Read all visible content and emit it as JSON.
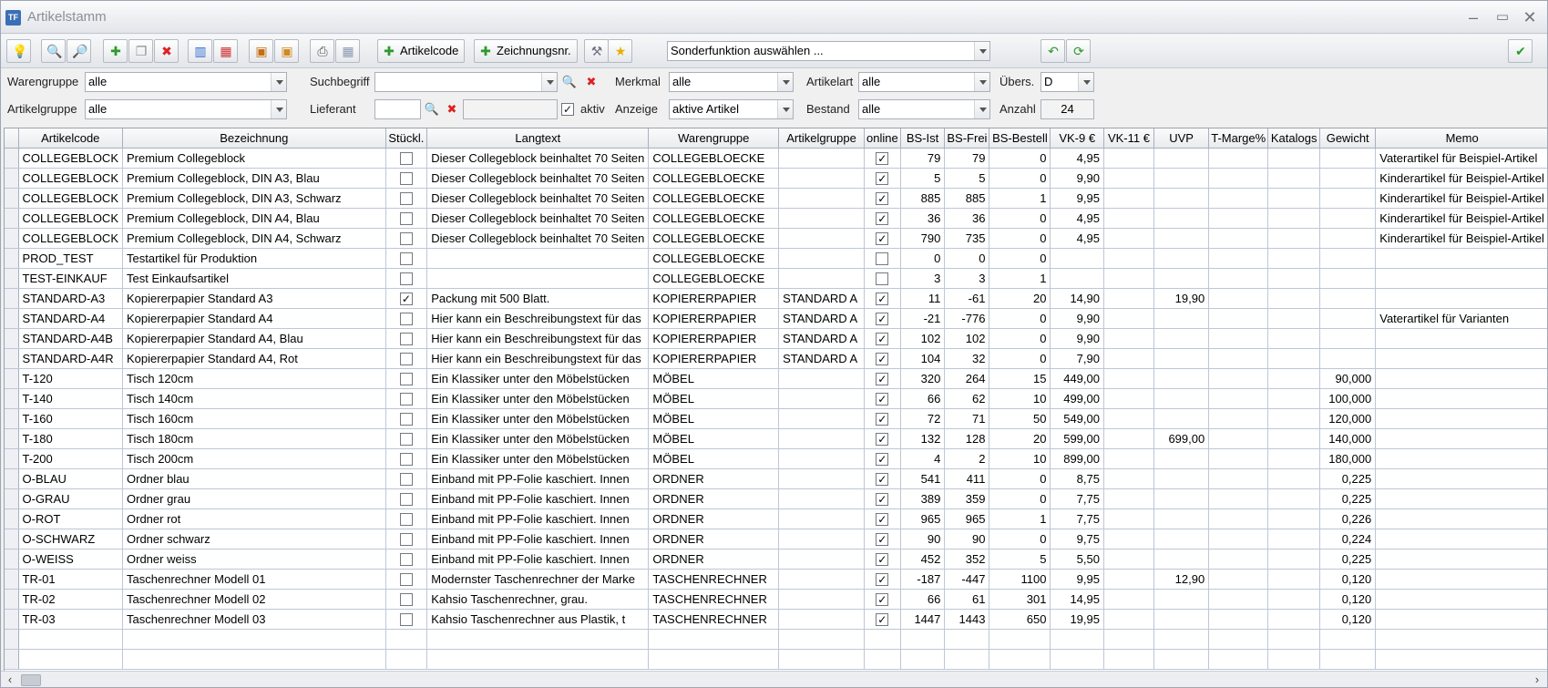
{
  "window": {
    "title": "Artikelstamm",
    "app_icon_text": "TF",
    "minimize": "–",
    "maximize": "▭",
    "close": "✕"
  },
  "toolbar": {
    "artikelcode_label": "Artikelcode",
    "zeichnungsnr_label": "Zeichnungsnr.",
    "sonderfunktion_value": "Sonderfunktion auswählen ..."
  },
  "filters": {
    "warengruppe_label": "Warengruppe",
    "warengruppe_value": "alle",
    "artikelgruppe_label": "Artikelgruppe",
    "artikelgruppe_value": "alle",
    "suchbegriff_label": "Suchbegriff",
    "suchbegriff_value": "",
    "lieferant_label": "Lieferant",
    "lieferant_value": "",
    "aktiv_label": "aktiv",
    "merkmal_label": "Merkmal",
    "merkmal_value": "alle",
    "anzeige_label": "Anzeige",
    "anzeige_value": "aktive Artikel",
    "artikelart_label": "Artikelart",
    "artikelart_value": "alle",
    "bestand_label": "Bestand",
    "bestand_value": "alle",
    "uebers_label": "Übers.",
    "uebers_value": "D",
    "anzahl_label": "Anzahl",
    "anzahl_value": "24"
  },
  "table": {
    "columns": [
      "Artikelcode",
      "Bezeichnung",
      "Stückl.",
      "Langtext",
      "Warengruppe",
      "Artikelgruppe",
      "online",
      "BS-Ist",
      "BS-Frei",
      "BS-Bestell",
      "VK-9 €",
      "VK-11 €",
      "UVP",
      "T-Marge%",
      "Katalogs",
      "Gewicht",
      "Memo"
    ],
    "rows": [
      [
        "COLLEGEBLOCK",
        "Premium Collegeblock",
        false,
        "Dieser Collegeblock beinhaltet 70 Seiten",
        "COLLEGEBLOECKE",
        "",
        true,
        "79",
        "79",
        "0",
        "4,95",
        "",
        "",
        "",
        "",
        "",
        "Vaterartikel für Beispiel-Artikel"
      ],
      [
        "COLLEGEBLOCK",
        "Premium Collegeblock, DIN A3, Blau",
        false,
        "Dieser Collegeblock beinhaltet 70 Seiten",
        "COLLEGEBLOECKE",
        "",
        true,
        "5",
        "5",
        "0",
        "9,90",
        "",
        "",
        "",
        "",
        "",
        "Kinderartikel für Beispiel-Artikel"
      ],
      [
        "COLLEGEBLOCK",
        "Premium Collegeblock, DIN A3, Schwarz",
        false,
        "Dieser Collegeblock beinhaltet 70 Seiten",
        "COLLEGEBLOECKE",
        "",
        true,
        "885",
        "885",
        "1",
        "9,95",
        "",
        "",
        "",
        "",
        "",
        "Kinderartikel für Beispiel-Artikel"
      ],
      [
        "COLLEGEBLOCK",
        "Premium Collegeblock, DIN A4, Blau",
        false,
        "Dieser Collegeblock beinhaltet 70 Seiten",
        "COLLEGEBLOECKE",
        "",
        true,
        "36",
        "36",
        "0",
        "4,95",
        "",
        "",
        "",
        "",
        "",
        "Kinderartikel für Beispiel-Artikel"
      ],
      [
        "COLLEGEBLOCK",
        "Premium Collegeblock, DIN A4, Schwarz",
        false,
        "Dieser Collegeblock beinhaltet 70 Seiten",
        "COLLEGEBLOECKE",
        "",
        true,
        "790",
        "735",
        "0",
        "4,95",
        "",
        "",
        "",
        "",
        "",
        "Kinderartikel für Beispiel-Artikel"
      ],
      [
        "PROD_TEST",
        "Testartikel für Produktion",
        false,
        "",
        "COLLEGEBLOECKE",
        "",
        false,
        "0",
        "0",
        "0",
        "",
        "",
        "",
        "",
        "",
        "",
        ""
      ],
      [
        "TEST-EINKAUF",
        "Test Einkaufsartikel",
        false,
        "",
        "COLLEGEBLOECKE",
        "",
        false,
        "3",
        "3",
        "1",
        "",
        "",
        "",
        "",
        "",
        "",
        ""
      ],
      [
        "STANDARD-A3",
        "Kopiererpapier Standard A3",
        true,
        "Packung mit 500 Blatt.",
        "KOPIERERPAPIER",
        "STANDARD A",
        true,
        "11",
        "-61",
        "20",
        "14,90",
        "",
        "19,90",
        "",
        "",
        "",
        ""
      ],
      [
        "STANDARD-A4",
        "Kopiererpapier Standard A4",
        false,
        "Hier kann ein Beschreibungstext für das",
        "KOPIERERPAPIER",
        "STANDARD A",
        true,
        "-21",
        "-776",
        "0",
        "9,90",
        "",
        "",
        "",
        "",
        "",
        "Vaterartikel für Varianten"
      ],
      [
        "STANDARD-A4B",
        "Kopiererpapier Standard A4, Blau",
        false,
        "Hier kann ein Beschreibungstext für das",
        "KOPIERERPAPIER",
        "STANDARD A",
        true,
        "102",
        "102",
        "0",
        "9,90",
        "",
        "",
        "",
        "",
        "",
        ""
      ],
      [
        "STANDARD-A4R",
        "Kopiererpapier Standard A4, Rot",
        false,
        "Hier kann ein Beschreibungstext für das",
        "KOPIERERPAPIER",
        "STANDARD A",
        true,
        "104",
        "32",
        "0",
        "7,90",
        "",
        "",
        "",
        "",
        "",
        ""
      ],
      [
        "T-120",
        "Tisch 120cm",
        false,
        "Ein Klassiker unter den Möbelstücken",
        "MÖBEL",
        "",
        true,
        "320",
        "264",
        "15",
        "449,00",
        "",
        "",
        "",
        "",
        "90,000",
        ""
      ],
      [
        "T-140",
        "Tisch 140cm",
        false,
        "Ein Klassiker unter den Möbelstücken",
        "MÖBEL",
        "",
        true,
        "66",
        "62",
        "10",
        "499,00",
        "",
        "",
        "",
        "",
        "100,000",
        ""
      ],
      [
        "T-160",
        "Tisch 160cm",
        false,
        "Ein Klassiker unter den Möbelstücken",
        "MÖBEL",
        "",
        true,
        "72",
        "71",
        "50",
        "549,00",
        "",
        "",
        "",
        "",
        "120,000",
        ""
      ],
      [
        "T-180",
        "Tisch 180cm",
        false,
        "Ein Klassiker unter den Möbelstücken",
        "MÖBEL",
        "",
        true,
        "132",
        "128",
        "20",
        "599,00",
        "",
        "699,00",
        "",
        "",
        "140,000",
        ""
      ],
      [
        "T-200",
        "Tisch 200cm",
        false,
        "Ein Klassiker unter den Möbelstücken",
        "MÖBEL",
        "",
        true,
        "4",
        "2",
        "10",
        "899,00",
        "",
        "",
        "",
        "",
        "180,000",
        ""
      ],
      [
        "O-BLAU",
        "Ordner blau",
        false,
        "Einband mit PP-Folie kaschiert. Innen",
        "ORDNER",
        "",
        true,
        "541",
        "411",
        "0",
        "8,75",
        "",
        "",
        "",
        "",
        "0,225",
        ""
      ],
      [
        "O-GRAU",
        "Ordner grau",
        false,
        "Einband mit PP-Folie kaschiert. Innen",
        "ORDNER",
        "",
        true,
        "389",
        "359",
        "0",
        "7,75",
        "",
        "",
        "",
        "",
        "0,225",
        ""
      ],
      [
        "O-ROT",
        "Ordner rot",
        false,
        "Einband mit PP-Folie kaschiert. Innen",
        "ORDNER",
        "",
        true,
        "965",
        "965",
        "1",
        "7,75",
        "",
        "",
        "",
        "",
        "0,226",
        ""
      ],
      [
        "O-SCHWARZ",
        "Ordner schwarz",
        false,
        "Einband mit PP-Folie kaschiert. Innen",
        "ORDNER",
        "",
        true,
        "90",
        "90",
        "0",
        "9,75",
        "",
        "",
        "",
        "",
        "0,224",
        ""
      ],
      [
        "O-WEISS",
        "Ordner weiss",
        false,
        "Einband mit PP-Folie kaschiert. Innen",
        "ORDNER",
        "",
        true,
        "452",
        "352",
        "5",
        "5,50",
        "",
        "",
        "",
        "",
        "0,225",
        ""
      ],
      [
        "TR-01",
        "Taschenrechner Modell 01",
        false,
        "Modernster Taschenrechner der Marke",
        "TASCHENRECHNER",
        "",
        true,
        "-187",
        "-447",
        "1100",
        "9,95",
        "",
        "12,90",
        "",
        "",
        "0,120",
        ""
      ],
      [
        "TR-02",
        "Taschenrechner Modell 02",
        false,
        "Kahsio Taschenrechner, grau.",
        "TASCHENRECHNER",
        "",
        true,
        "66",
        "61",
        "301",
        "14,95",
        "",
        "",
        "",
        "",
        "0,120",
        ""
      ],
      [
        "TR-03",
        "Taschenrechner Modell 03",
        false,
        "Kahsio Taschenrechner aus Plastik, t",
        "TASCHENRECHNER",
        "",
        true,
        "1447",
        "1443",
        "650",
        "19,95",
        "",
        "",
        "",
        "",
        "0,120",
        ""
      ]
    ]
  },
  "scrollbar": {
    "left_arrow": "‹",
    "right_arrow": "›"
  }
}
